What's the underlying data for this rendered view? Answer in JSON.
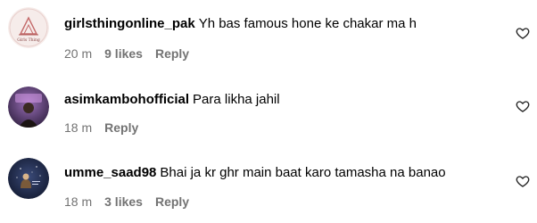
{
  "comments": [
    {
      "username": "girlsthingonline_pak",
      "text": "Yh bas famous hone ke chakar ma h",
      "time": "20 m",
      "likes": "9 likes",
      "reply": "Reply",
      "avatar_icon": "girlsthing-logo-avatar",
      "like_icon": "heart-outline-icon"
    },
    {
      "username": "asimkambohofficial",
      "text": "Para likha jahil",
      "time": "18 m",
      "likes": null,
      "reply": "Reply",
      "avatar_icon": "profile-photo-avatar",
      "like_icon": "heart-outline-icon"
    },
    {
      "username": "umme_saad98",
      "text": "Bhai ja kr ghr main baat karo tamasha na banao",
      "time": "18 m",
      "likes": "3 likes",
      "reply": "Reply",
      "avatar_icon": "night-sky-avatar",
      "like_icon": "heart-outline-icon"
    }
  ]
}
